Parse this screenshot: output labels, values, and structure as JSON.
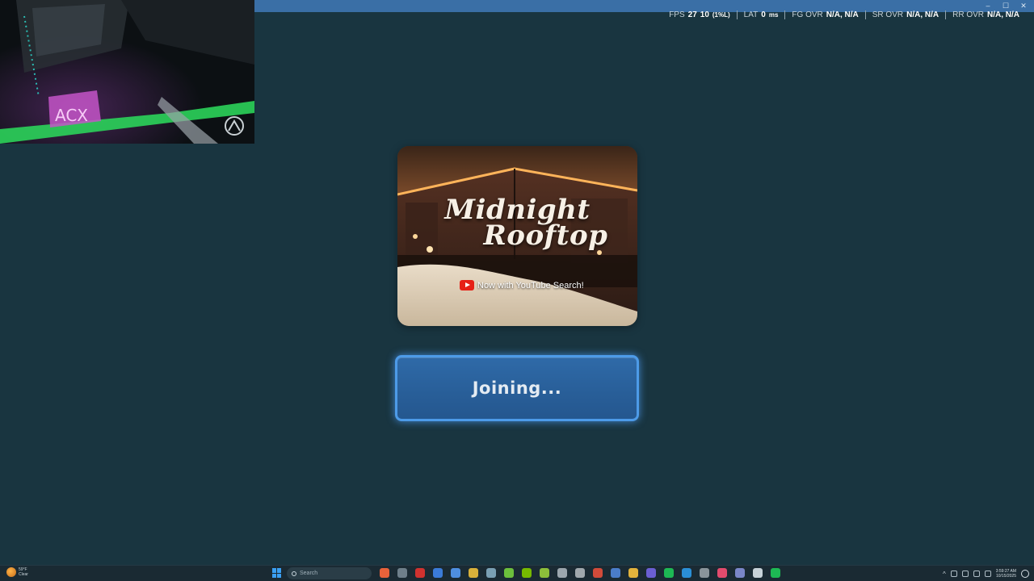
{
  "window": {
    "controls": {
      "minimize": "–",
      "maximize": "☐",
      "close": "✕"
    }
  },
  "perf_overlay": {
    "fps_label": "FPS",
    "fps_value": "27",
    "fps_low_value": "10",
    "fps_low_unit": "(1%L)",
    "lat_label": "LAT",
    "lat_value": "0",
    "lat_unit": "ms",
    "fg_label": "FG OVR",
    "fg_value": "N/A, N/A",
    "sr_label": "SR OVR",
    "sr_value": "N/A, N/A",
    "rr_label": "RR OVR",
    "rr_value": "N/A, N/A"
  },
  "world": {
    "title_line1": "Midnight",
    "title_line2": "Rooftop",
    "tagline": "Now with YouTube Search!"
  },
  "join_button": {
    "label": "Joining..."
  },
  "taskbar": {
    "weather_temp": "59°F",
    "weather_desc": "Clear",
    "search_placeholder": "Search",
    "clock_time": "3:59:27 AM",
    "clock_date": "10/15/2025",
    "apps": [
      {
        "name": "app-1",
        "color": "#e8623a"
      },
      {
        "name": "app-2",
        "color": "#6e7f8a"
      },
      {
        "name": "app-3",
        "color": "#d0322f"
      },
      {
        "name": "app-4",
        "color": "#3b7bd8"
      },
      {
        "name": "app-5",
        "color": "#4e8fe0"
      },
      {
        "name": "app-6",
        "color": "#d9b13a"
      },
      {
        "name": "app-7",
        "color": "#7aa0b4"
      },
      {
        "name": "app-8",
        "color": "#6cbf3c"
      },
      {
        "name": "app-9",
        "color": "#76b900"
      },
      {
        "name": "app-10",
        "color": "#8cbf3a"
      },
      {
        "name": "app-11",
        "color": "#9ba6ad"
      },
      {
        "name": "app-12",
        "color": "#a0a8ad"
      },
      {
        "name": "app-13",
        "color": "#d24b3a"
      },
      {
        "name": "app-14",
        "color": "#4a7dc9"
      },
      {
        "name": "app-15",
        "color": "#e2b33c"
      },
      {
        "name": "app-16",
        "color": "#6b5fd3"
      },
      {
        "name": "app-17",
        "color": "#1db954"
      },
      {
        "name": "app-18",
        "color": "#2a8fd6"
      },
      {
        "name": "app-19",
        "color": "#8a959b"
      },
      {
        "name": "app-20",
        "color": "#e34b6d"
      },
      {
        "name": "app-21",
        "color": "#7a86c8"
      },
      {
        "name": "app-22",
        "color": "#c7d2d8"
      },
      {
        "name": "app-23",
        "color": "#1db954"
      }
    ]
  }
}
